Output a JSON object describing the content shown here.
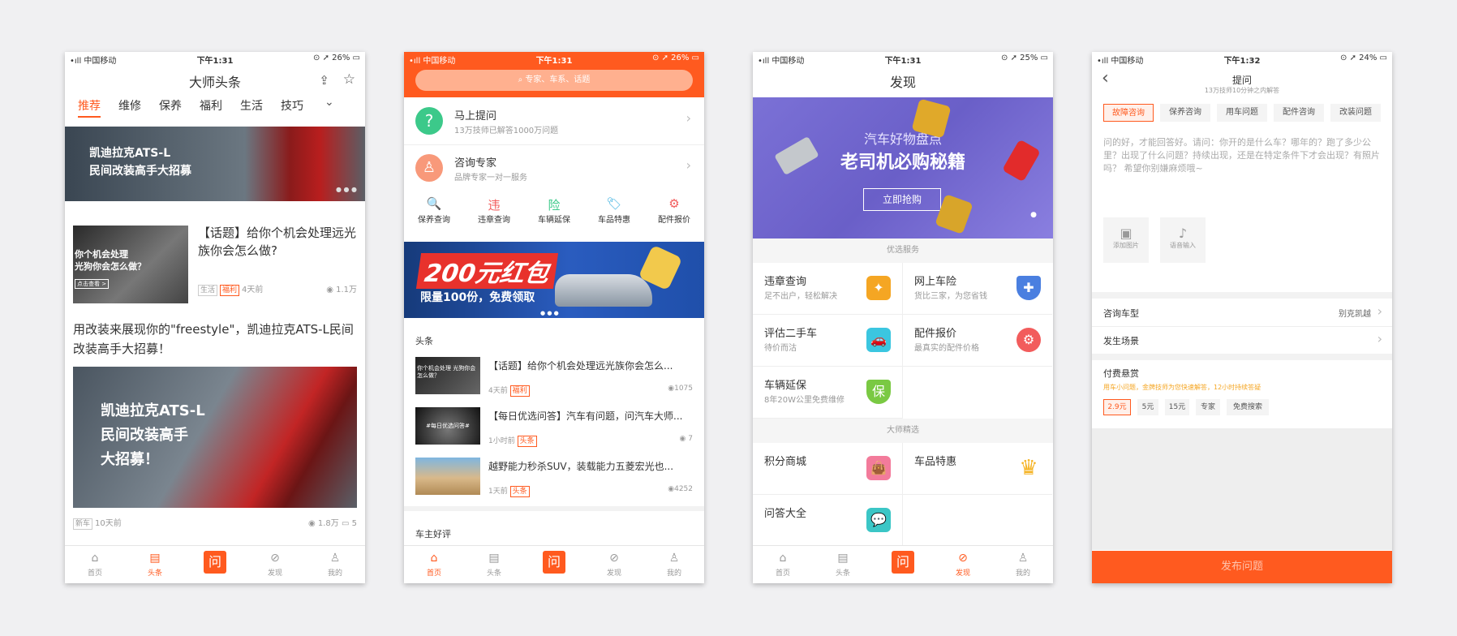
{
  "status": {
    "carrier": "•ıll 中国移动",
    "p1_time": "下午1:31",
    "p1_batt": "⊙ ➚ 26% ▭",
    "p2_time": "下午1:31",
    "p2_batt": "⊙ ➚ 26% ▭",
    "p3_time": "下午1:31",
    "p3_batt": "⊙ ➚ 25% ▭",
    "p4_time": "下午1:32",
    "p4_batt": "⊙ ➚ 24% ▭"
  },
  "tabbar": {
    "home": "首页",
    "news": "头条",
    "ask": "问",
    "discover": "发现",
    "mine": "我的"
  },
  "p1": {
    "title": "大师头条",
    "tabs": [
      "推荐",
      "维修",
      "保养",
      "福利",
      "生活",
      "技巧"
    ],
    "banner_l1": "凯迪拉克ATS-L",
    "banner_l2": "民间改装高手大招募",
    "art1_title": "【话题】给你个机会处理远光族你会怎么做?",
    "art1_thumb": "你个机会处理\n光狗你会怎么做？",
    "art1_thumb_btn": "点击查看 >",
    "art1_tags": [
      "生活",
      "福利"
    ],
    "art1_time": "4天前",
    "art1_views": "1.1万",
    "art2_title": "用改装来展现你的\"freestyle\"，凯迪拉克ATS-L民间改装高手大招募！",
    "art2_img_l1": "凯迪拉克ATS-L",
    "art2_img_l2": "民间改装高手",
    "art2_img_l3": "大招募！",
    "art2_tag": "新车",
    "art2_time": "10天前",
    "art2_views": "1.8万",
    "art2_comments": "5"
  },
  "p2": {
    "search_placeholder": "专家、车系、话题",
    "ask_title": "马上提问",
    "ask_sub": "13万技师已解答1000万问题",
    "expert_title": "咨询专家",
    "expert_sub": "品牌专家一对一服务",
    "services": [
      "保养查询",
      "违章查询",
      "车辆延保",
      "车品特惠",
      "配件报价"
    ],
    "service_glyphs": [
      "🔍",
      "违",
      "险",
      "🏷",
      "⚙"
    ],
    "promo_big": "200元红包",
    "promo_small": "限量100份，免费领取",
    "section_news": "头条",
    "news": [
      {
        "title": "【话题】给你个机会处理远光族你会怎么...",
        "time": "4天前",
        "tag": "福利",
        "views": "1075",
        "thumb": "你个机会处理 光狗你会怎么做？"
      },
      {
        "title": "【每日优选问答】汽车有问题，问汽车大师...",
        "time": "1小时前",
        "tag": "头条",
        "views": "7",
        "thumb": "#每日优选问答#"
      },
      {
        "title": "越野能力秒杀SUV，装载能力五菱宏光也...",
        "time": "1天前",
        "tag": "头条",
        "views": "4252",
        "thumb": ""
      }
    ],
    "section_reviews": "车主好评"
  },
  "p3": {
    "title": "发现",
    "banner_l1": "汽车好物盘点",
    "banner_l2": "老司机必购秘籍",
    "banner_btn": "立即抢购",
    "sec1": "优选服务",
    "services": [
      {
        "name": "违章查询",
        "sub": "足不出户，轻松解决",
        "color": "#f5a623",
        "glyph": "✦"
      },
      {
        "name": "网上车险",
        "sub": "货比三家，为您省钱",
        "color": "#4a7fe0",
        "glyph": "✚"
      },
      {
        "name": "评估二手车",
        "sub": "待价而沽",
        "color": "#3bc6e0",
        "glyph": "🚗"
      },
      {
        "name": "配件报价",
        "sub": "最真实的配件价格",
        "color": "#f25c5c",
        "glyph": "⚙"
      },
      {
        "name": "车辆延保",
        "sub": "8年20W公里免费维修",
        "color": "#7ac943",
        "glyph": "保"
      }
    ],
    "sec2": "大师精选",
    "picks": [
      {
        "name": "积分商城",
        "color": "#f37b9b",
        "glyph": "👜"
      },
      {
        "name": "车品特惠",
        "color": "#f5b323",
        "glyph": "♛"
      },
      {
        "name": "问答大全",
        "color": "#3bc6c6",
        "glyph": "💬"
      }
    ]
  },
  "p4": {
    "title": "提问",
    "subtitle": "13万技师10分钟之内解答",
    "chips": [
      "故障咨询",
      "保养咨询",
      "用车问题",
      "配件咨询",
      "改装问题"
    ],
    "placeholder": "问的好，才能回答好。请问：你开的是什么车？哪年的？跑了多少公里？出现了什么问题？持续出现，还是在特定条件下才会出现？有照片吗？ 希望你别嫌麻烦哦~",
    "add_image": "添加图片",
    "voice_input": "语音输入",
    "car_model_label": "咨询车型",
    "car_model_value": "别克凯越",
    "scene_label": "发生场景",
    "reward_label": "付费悬赏",
    "reward_hint": "用车小问题，金牌技师为您快速解答，12小时持续答疑",
    "reward_options": [
      "2.9元",
      "5元",
      "15元",
      "专家",
      "免费搜索"
    ],
    "submit": "发布问题"
  }
}
